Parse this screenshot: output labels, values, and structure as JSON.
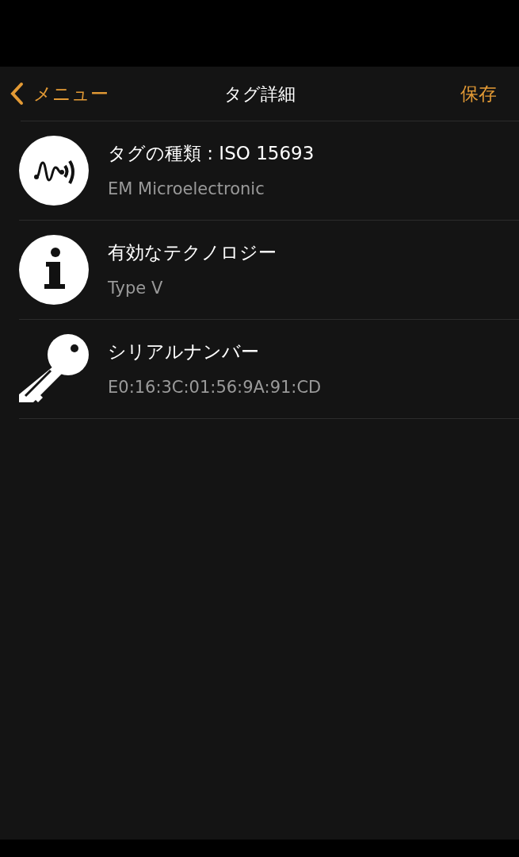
{
  "nav": {
    "back": "メニュー",
    "title": "タグ詳細",
    "action": "保存"
  },
  "rows": [
    {
      "kind": "nfc",
      "title": "タグの種類 : ISO 15693",
      "detail": "EM Microelectronic"
    },
    {
      "kind": "info",
      "title": "有効なテクノロジー",
      "detail": "Type V"
    },
    {
      "kind": "key",
      "title": "シリアルナンバー",
      "detail": "E0:16:3C:01:56:9A:91:CD"
    }
  ]
}
